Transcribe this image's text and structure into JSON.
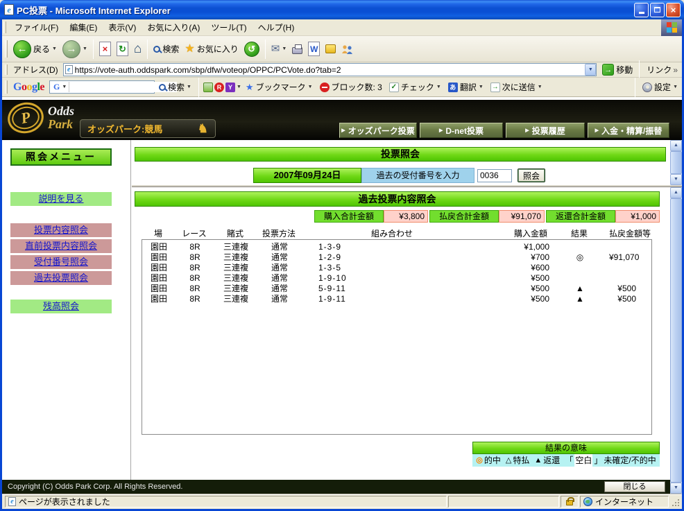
{
  "window": {
    "title": "PC投票 - Microsoft Internet Explorer"
  },
  "menu_bar": [
    "ファイル(F)",
    "編集(E)",
    "表示(V)",
    "お気に入り(A)",
    "ツール(T)",
    "ヘルプ(H)"
  ],
  "toolbar": {
    "back": "戻る",
    "search": "検索",
    "favorites": "お気に入り"
  },
  "address_bar": {
    "label": "アドレス(D)",
    "url": "https://vote-auth.oddspark.com/sbp/dfw/voteop/OPPC/PCVote.do?tab=2",
    "go": "移動",
    "links": "リンク"
  },
  "google_bar": {
    "brand_letters": [
      "G",
      "o",
      "o",
      "g",
      "l",
      "e"
    ],
    "g_logo": "G",
    "search": "検索",
    "bookmarks": "ブックマーク",
    "blocked": "ブロック数: 3",
    "check": "チェック",
    "translate": "翻訳",
    "send_to": "次に送信",
    "settings": "設定"
  },
  "site_header": {
    "logo_letter": "P",
    "brand_line1": "Odds",
    "brand_line2": "Park",
    "badge": "オッズパーク:競馬",
    "nav": [
      {
        "label": "オッズパーク投票"
      },
      {
        "label": "D-net投票"
      },
      {
        "label": "投票履歴"
      },
      {
        "label": "入金・精算/振替"
      }
    ]
  },
  "sidebar": {
    "title": "照会メニュー",
    "items": [
      {
        "label": "説明を見る"
      },
      {
        "label": "投票内容照会"
      },
      {
        "label": "直前投票内容照会"
      },
      {
        "label": "受付番号照会"
      },
      {
        "label": "過去投票照会"
      },
      {
        "label": "残高照会"
      }
    ]
  },
  "inquiry_panel": {
    "title": "投票照会",
    "date": "2007年09月24日",
    "receipt_label": "過去の受付番号を入力",
    "receipt_value": "0036",
    "submit": "照会"
  },
  "results_panel": {
    "title": "過去投票内容照会",
    "summary": [
      {
        "label": "購入合計金額",
        "value": "¥3,800"
      },
      {
        "label": "払戻合計金額",
        "value": "¥91,070"
      },
      {
        "label": "返還合計金額",
        "value": "¥1,000"
      }
    ],
    "headers": [
      "場",
      "レース",
      "賭式",
      "投票方法",
      "組み合わせ",
      "購入金額",
      "結果",
      "払戻金額等"
    ],
    "rows": [
      {
        "place": "園田",
        "race": "8R",
        "type": "三連複",
        "method": "通常",
        "combo": "1-3-9",
        "amount": "¥1,000",
        "result": "",
        "payout": ""
      },
      {
        "place": "園田",
        "race": "8R",
        "type": "三連複",
        "method": "通常",
        "combo": "1-2-9",
        "amount": "¥700",
        "result": "◎",
        "payout": "¥91,070"
      },
      {
        "place": "園田",
        "race": "8R",
        "type": "三連複",
        "method": "通常",
        "combo": "1-3-5",
        "amount": "¥600",
        "result": "",
        "payout": ""
      },
      {
        "place": "園田",
        "race": "8R",
        "type": "三連複",
        "method": "通常",
        "combo": "1-9-10",
        "amount": "¥500",
        "result": "",
        "payout": ""
      },
      {
        "place": "園田",
        "race": "8R",
        "type": "三連複",
        "method": "通常",
        "combo": "5-9-11",
        "amount": "¥500",
        "result": "▲",
        "payout": "¥500"
      },
      {
        "place": "園田",
        "race": "8R",
        "type": "三連複",
        "method": "通常",
        "combo": "1-9-11",
        "amount": "¥500",
        "result": "▲",
        "payout": "¥500"
      }
    ],
    "legend": {
      "title": "結果の意味",
      "hit_symbol": "◎",
      "hit_label": "的中",
      "special_symbol": "△",
      "special_label": "特払",
      "refund_symbol": "▲",
      "refund_label": "返還",
      "blank_open": "「",
      "blank_word": "空白",
      "blank_close": "」",
      "blank_label": "未確定/不的中"
    }
  },
  "footer": {
    "copyright": "Copyright (C) Odds Park Corp. All Rights Reserved.",
    "close": "閉じる"
  },
  "status_bar": {
    "message": "ページが表示されました",
    "zone": "インターネット"
  },
  "icons": {
    "ie_logo": "e",
    "back": "←",
    "forward": "→",
    "stop": "×",
    "refresh": "↻",
    "home": "⌂",
    "history": "↺",
    "star": "★",
    "mail": "✉",
    "word": "W",
    "dropdown": "▼",
    "links_chevron": "»",
    "check": "✓",
    "send": "→",
    "wrench": " ",
    "nav_arrow": "▶",
    "horse": "♞",
    "scroll_up": "▲",
    "scroll_down": "▼"
  },
  "colors": {
    "accent_green": "#66CC22",
    "sidebar_pink": "#CC9999",
    "sidebar_green": "#A2EA84",
    "value_pink": "#FFD2CA",
    "legend_cyan": "#B6F2F2",
    "header_olive": "#6A7A44",
    "hit_orange": "#FF8800",
    "xp_blue": "#0C50D2"
  }
}
